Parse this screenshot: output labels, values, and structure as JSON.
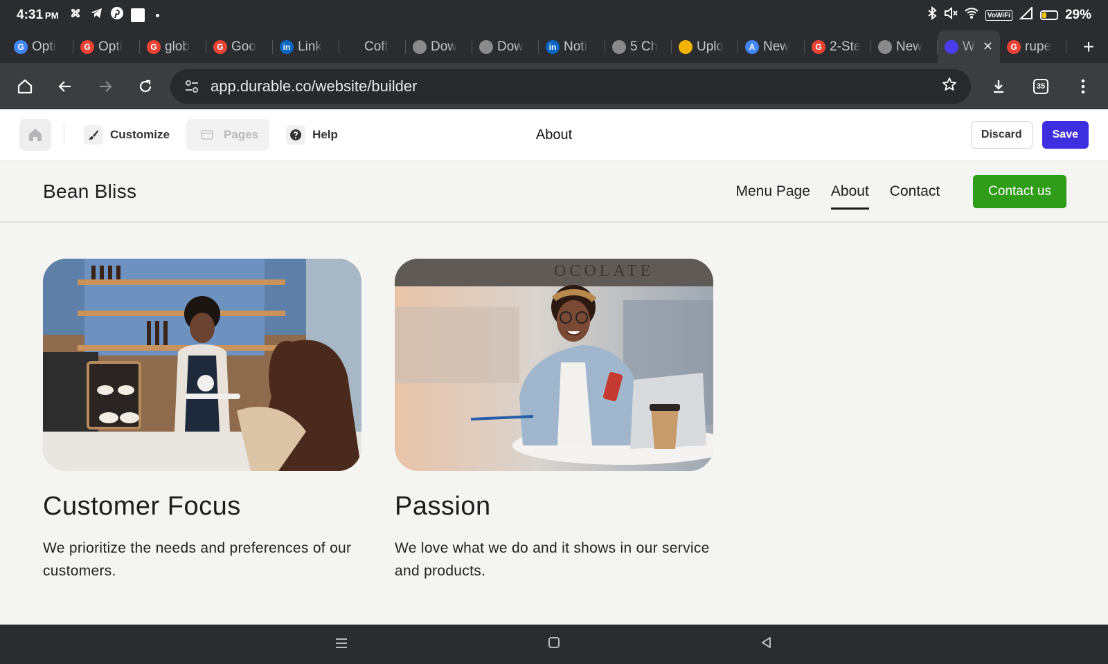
{
  "status_bar": {
    "time": "4:31",
    "ampm": "PM",
    "battery": "29%",
    "battery_level": 0.29,
    "icons": [
      "fan-icon",
      "telegram-icon",
      "pinterest-icon",
      "news-icon",
      "dot-icon",
      "bluetooth-icon",
      "mute-icon",
      "wifi-icon",
      "vowifi-icon",
      "signal-icon",
      "battery-icon"
    ],
    "vowifi": "VoWiFi"
  },
  "tabs": [
    {
      "title": "Opti",
      "fav": "G",
      "color": "#4285f4"
    },
    {
      "title": "Opti",
      "fav": "G",
      "color": "#ea4335"
    },
    {
      "title": "glob",
      "fav": "G",
      "color": "#ea4335"
    },
    {
      "title": "Goo",
      "fav": "G",
      "color": "#ea4335"
    },
    {
      "title": "Link",
      "fav": "in",
      "color": "#0a66c2"
    },
    {
      "title": "Coff",
      "fav": "",
      "color": "#2b2c30"
    },
    {
      "title": "Dow",
      "fav": "",
      "color": "#8a8a8a"
    },
    {
      "title": "Dow",
      "fav": "",
      "color": "#8a8a8a"
    },
    {
      "title": "Noti",
      "fav": "in",
      "color": "#0a66c2"
    },
    {
      "title": "5 Ch",
      "fav": "",
      "color": "#8a8a8a"
    },
    {
      "title": "Uplo",
      "fav": "",
      "color": "#f3b400"
    },
    {
      "title": "New",
      "fav": "A",
      "color": "#4285f4"
    },
    {
      "title": "2-Ste",
      "fav": "G",
      "color": "#ea4335"
    },
    {
      "title": "New",
      "fav": "",
      "color": "#8a8a8a"
    },
    {
      "title": "W",
      "fav": "",
      "color": "#4b3cf0",
      "active": true
    },
    {
      "title": "rupe",
      "fav": "G",
      "color": "#ea4335"
    }
  ],
  "address_bar": {
    "url": "app.durable.co/website/builder",
    "tab_count": "35"
  },
  "builder": {
    "customize": "Customize",
    "pages": "Pages",
    "help": "Help",
    "current_page": "About",
    "discard": "Discard",
    "save": "Save"
  },
  "site": {
    "brand": "Bean Bliss",
    "nav": [
      "Menu Page",
      "About",
      "Contact"
    ],
    "active_nav": "About",
    "cta": "Contact us",
    "cta_color": "#2f9d17"
  },
  "cards": [
    {
      "title": "Customer Focus",
      "text": "We prioritize the needs and preferences of our customers."
    },
    {
      "title": "Passion",
      "text": "We love what we do and it shows in our service and products."
    }
  ],
  "accent": "#3d2ee0"
}
